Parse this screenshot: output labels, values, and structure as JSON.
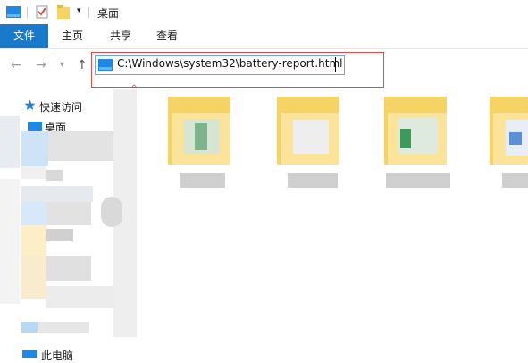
{
  "window": {
    "title": "桌面"
  },
  "ribbon": {
    "tabs": [
      {
        "label": "文件"
      },
      {
        "label": "主页"
      },
      {
        "label": "共享"
      },
      {
        "label": "查看"
      }
    ]
  },
  "address": {
    "path": "C:\\Windows\\system32\\battery-report.html"
  },
  "sidebar": {
    "quick_access": "快速访问",
    "desktop_label": "桌面",
    "this_pc_label": "此电脑"
  },
  "colors": {
    "accent": "#1979ca",
    "highlight_border": "#e04a4a"
  }
}
